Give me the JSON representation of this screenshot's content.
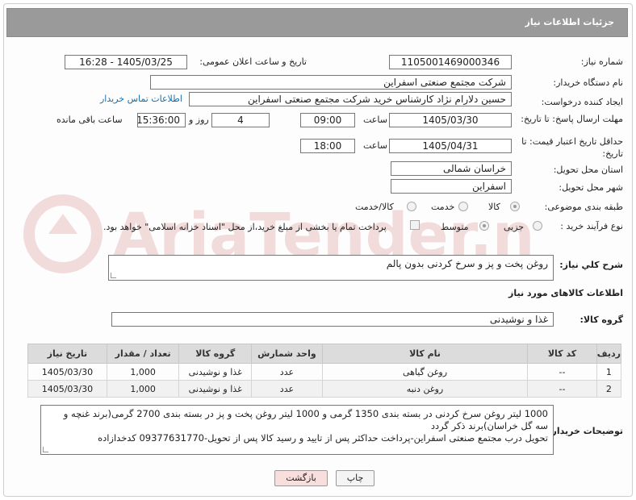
{
  "header": {
    "title": "جزئیات اطلاعات نیاز"
  },
  "fields": {
    "need_number_label": "شماره نیاز:",
    "need_number": "1105001469000346",
    "announce_label": "تاریخ و ساعت اعلان عمومی:",
    "announce_value": "1405/03/25 - 16:28",
    "buyer_org_label": "نام دستگاه خریدار:",
    "buyer_org": "شرکت مجتمع صنعتی اسفراین",
    "creator_label": "ایجاد کننده درخواست:",
    "creator": "حسین دلارام نژاد کارشناس خرید شرکت مجتمع صنعتی اسفراین",
    "contact_link": "اطلاعات تماس خریدار",
    "deadline_label": "مهلت ارسال پاسخ: تا تاریخ:",
    "deadline_date": "1405/03/30",
    "time_label": "ساعت",
    "deadline_time": "09:00",
    "days_value": "4",
    "days_label": "روز و",
    "remaining_time": "15:36:00",
    "remaining_label": "ساعت باقی مانده",
    "price_validity_label": "حداقل تاریخ اعتبار قیمت: تا تاریخ:",
    "price_date": "1405/04/31",
    "price_time": "18:00",
    "province_label": "استان محل تحویل:",
    "province": "خراسان شمالی",
    "city_label": "شهر محل تحویل:",
    "city": "اسفراین",
    "category_label": "طبقه بندی موضوعی:",
    "category_options": [
      "کالا",
      "خدمت",
      "کالا/خدمت"
    ],
    "process_label": "نوع فرآیند خرید :",
    "process_options": [
      "جزیی",
      "متوسط"
    ],
    "payment_note": "پرداخت تمام یا بخشی از مبلغ خرید،از محل \"اسناد خزانه اسلامی\" خواهد بود."
  },
  "summary": {
    "label": "شرح کلي نياز:",
    "value": "روغن پخت و پز و سرخ کردنی بدون پالم"
  },
  "goods": {
    "section_title": "اطلاعات کالاهای مورد نیاز",
    "group_label": "گروه کالا:",
    "group_value": "غذا و نوشیدنی"
  },
  "table": {
    "headers": [
      "ردیف",
      "کد کالا",
      "نام کالا",
      "واحد شمارش",
      "گروه کالا",
      "تعداد / مقدار",
      "تاریخ نیاز"
    ],
    "rows": [
      [
        "1",
        "--",
        "روغن گیاهی",
        "عدد",
        "غذا و نوشیدنی",
        "1,000",
        "1405/03/30"
      ],
      [
        "2",
        "--",
        "روغن دنبه",
        "عدد",
        "غذا و نوشیدنی",
        "1,000",
        "1405/03/30"
      ]
    ]
  },
  "notes": {
    "label": "توضیحات خریدار:",
    "line1": "1000 لیتر روغن سرخ کردنی در بسته بندی 1350 گرمی و 1000 لیتر روغن پخت و پز در بسته بندی 2700 گرمی(برند غنچه و",
    "line2": "سه گل خراسان)برند ذکر گردد",
    "line3": "تحویل درب مجتمع صنعتی اسفراین-پرداخت حداکثر پس از تایید و رسید کالا پس از تحویل-09377631770 کدخدازاده"
  },
  "buttons": {
    "print": "چاپ",
    "back": "بازگشت"
  },
  "watermark": {
    "text": "AriaTender.net"
  },
  "colors": {
    "header_bg": "#9a9a9a",
    "link": "#1a6ea8",
    "back_button_bg": "#f9dede"
  }
}
